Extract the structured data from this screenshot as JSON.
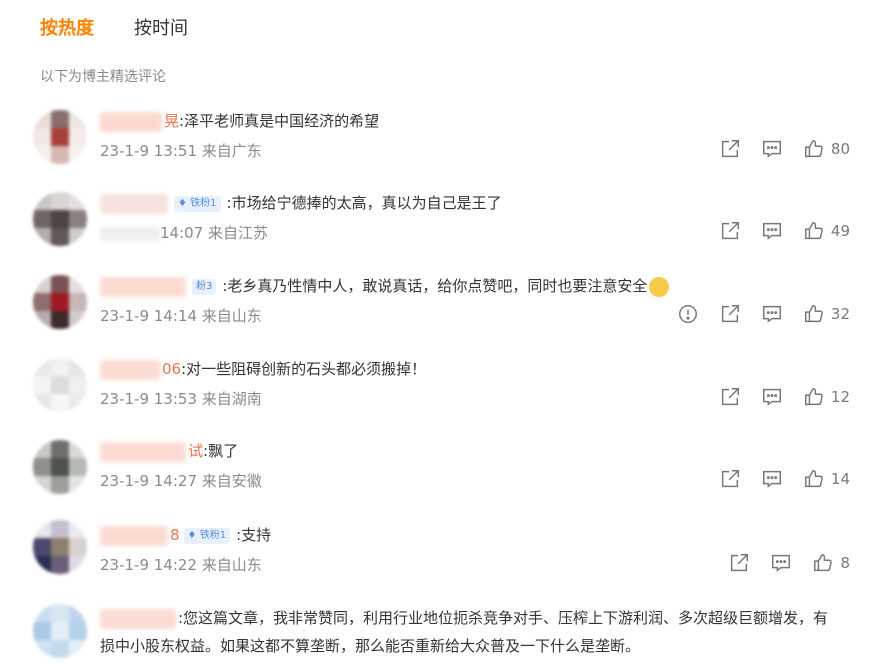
{
  "tabs": {
    "hot": "按热度",
    "time": "按时间"
  },
  "subtitle": "以下为博主精选评论",
  "colors": {
    "accent": "#ff8200",
    "name": "#eb7350",
    "badge_bg": "#e8f0fd",
    "badge_text": "#5a8de6",
    "meta": "#8a8a8a"
  },
  "icons": {
    "share": "share-icon",
    "reply": "comment-icon",
    "like": "thumb-up-icon",
    "report": "report-icon"
  },
  "comments": [
    {
      "name_tail": "晃",
      "badge": "",
      "text": ":泽平老师真是中国经济的希望",
      "time": "23-1-9 13:51 来自广东",
      "likes": "80"
    },
    {
      "name_tail": "",
      "badge": "铁粉1",
      "text": ":市场给宁德捧的太高，真以为自己是王了",
      "time": "14:07 来自江苏",
      "likes": "49"
    },
    {
      "name_tail": "",
      "badge": "粉3",
      "text": ":老乡真乃性情中人，敢说真话，给你点赞吧，同时也要注意安全",
      "time": "23-1-9 14:14 来自山东",
      "likes": "32"
    },
    {
      "name_tail": "06",
      "badge": "",
      "text": ":对一些阻碍创新的石头都必须搬掉！",
      "time": "23-1-9 13:53 来自湖南",
      "likes": "12"
    },
    {
      "name_tail": "试",
      "badge": "",
      "text": ":飘了",
      "time": "23-1-9 14:27 来自安徽",
      "likes": "14"
    },
    {
      "name_tail": "8",
      "badge": "铁粉1",
      "text": ":支持",
      "time": "23-1-9 14:22 来自山东",
      "likes": "8"
    }
  ],
  "last_comment": {
    "text": ":您这篇文章，我非常赞同，利用行业地位扼杀竞争对手、压榨上下游利润、多次超级巨额增发，有损中小股东权益。如果这都不算垄断，那么能否重新给大众普及一下什么是垄断。"
  }
}
